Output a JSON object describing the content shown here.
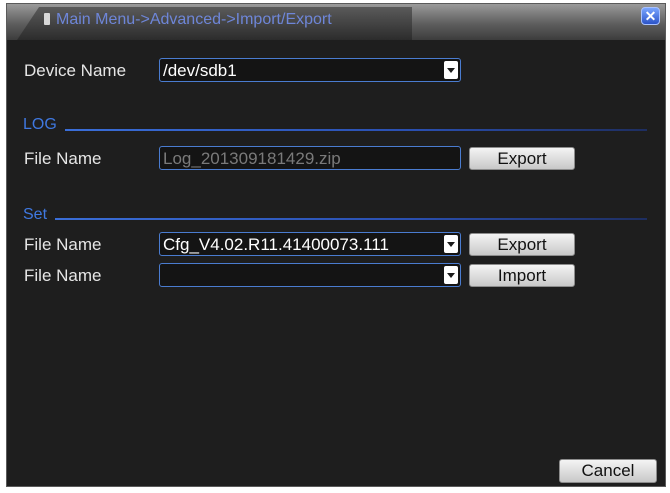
{
  "window": {
    "title": "Main Menu->Advanced->Import/Export",
    "close_glyph": "✕"
  },
  "device": {
    "label": "Device Name",
    "value": "/dev/sdb1"
  },
  "log": {
    "section_title": "LOG",
    "file_label": "File Name",
    "file_value": "Log_201309181429.zip",
    "export_label": "Export"
  },
  "set": {
    "section_title": "Set",
    "export_row": {
      "file_label": "File Name",
      "file_value": "Cfg_V4.02.R11.41400073.111",
      "button_label": "Export"
    },
    "import_row": {
      "file_label": "File Name",
      "file_value": "",
      "button_label": "Import"
    }
  },
  "footer": {
    "cancel_label": "Cancel"
  },
  "colors": {
    "accent": "#3f78e0",
    "title_text": "#6e86d8",
    "background": "#1e1e1e"
  }
}
